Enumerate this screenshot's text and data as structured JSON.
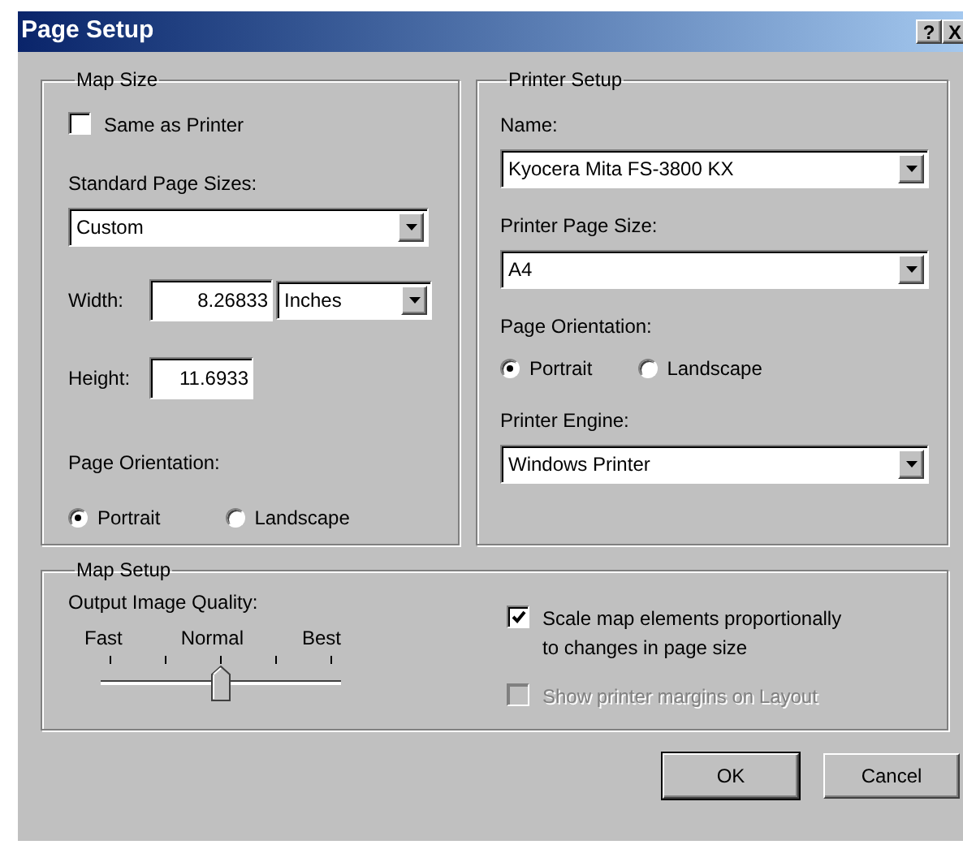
{
  "window": {
    "title": "Page Setup",
    "title_buttons": [
      {
        "label": "?"
      },
      {
        "label": "X"
      }
    ]
  },
  "map_size": {
    "title": "Map Size",
    "same_as_printer": {
      "label": "Same as Printer",
      "checked": false
    },
    "standard_page_sizes": {
      "label": "Standard Page Sizes:",
      "value": "Custom"
    },
    "width": {
      "label": "Width:",
      "value": "8.26833"
    },
    "units": {
      "value": "Inches"
    },
    "height": {
      "label": "Height:",
      "value": "11.6933"
    },
    "orientation": {
      "label": "Page Orientation:",
      "options": [
        {
          "label": "Portrait",
          "selected": true
        },
        {
          "label": "Landscape",
          "selected": false
        }
      ]
    }
  },
  "printer_setup": {
    "title": "Printer Setup",
    "name": {
      "label": "Name:",
      "value": "Kyocera Mita FS-3800 KX"
    },
    "page_size": {
      "label": "Printer Page Size:",
      "value": "A4"
    },
    "orientation": {
      "label": "Page Orientation:",
      "options": [
        {
          "label": "Portrait",
          "selected": true
        },
        {
          "label": "Landscape",
          "selected": false
        }
      ]
    },
    "engine": {
      "label": "Printer Engine:",
      "value": "Windows Printer"
    }
  },
  "map_setup": {
    "title": "Map Setup",
    "quality": {
      "label": "Output Image Quality:",
      "ticks": [
        "Fast",
        "Normal",
        "Best"
      ],
      "level": 0.5
    },
    "checkboxes": [
      {
        "label": "Scale map elements proportionally to changes in page size",
        "checked": true,
        "disabled": false
      },
      {
        "label": "Show printer margins on Layout",
        "checked": false,
        "disabled": true
      }
    ]
  },
  "buttons": [
    {
      "label": "OK",
      "default": true
    },
    {
      "label": "Cancel",
      "default": false
    }
  ]
}
